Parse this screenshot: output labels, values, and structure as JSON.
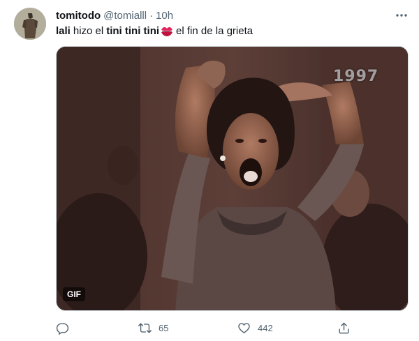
{
  "tweet": {
    "display_name": "tomitodo",
    "handle": "@tomialll",
    "separator": "·",
    "time": "10h",
    "text": {
      "part1": "lali",
      "part2": "hizo el",
      "part3": "tini tini tini",
      "part4": "el fin de la grieta"
    },
    "media": {
      "badge": "GIF",
      "watermark": "1997"
    },
    "actions": {
      "retweets": "65",
      "likes": "442"
    }
  },
  "icons": {
    "more": "more-horizontal-icon",
    "emoji": "kiss-mark-icon",
    "reply": "reply-icon",
    "retweet": "retweet-icon",
    "like": "heart-icon",
    "share": "share-icon"
  },
  "colors": {
    "text_primary": "#0f1419",
    "text_secondary": "#536471",
    "border": "#cfd9de"
  }
}
